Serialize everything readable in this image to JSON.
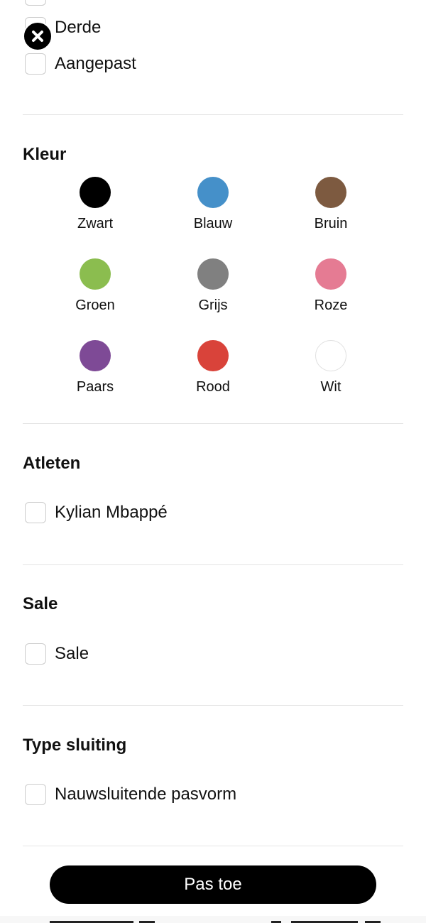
{
  "filters": {
    "top_options": [
      {
        "label": "Derde",
        "checked": false
      },
      {
        "label": "Aangepast",
        "checked": false
      }
    ],
    "colors": {
      "title": "Kleur",
      "swatches": [
        {
          "label": "Zwart",
          "color": "#000000"
        },
        {
          "label": "Blauw",
          "color": "#4590c9"
        },
        {
          "label": "Bruin",
          "color": "#7d5a40"
        },
        {
          "label": "Groen",
          "color": "#8bbd4f"
        },
        {
          "label": "Grijs",
          "color": "#808080"
        },
        {
          "label": "Roze",
          "color": "#e57b93"
        },
        {
          "label": "Paars",
          "color": "#7e4a96"
        },
        {
          "label": "Rood",
          "color": "#d9433a"
        },
        {
          "label": "Wit",
          "color": "#ffffff"
        }
      ]
    },
    "athletes": {
      "title": "Atleten",
      "options": [
        {
          "label": "Kylian Mbappé",
          "checked": false
        }
      ]
    },
    "sale": {
      "title": "Sale",
      "options": [
        {
          "label": "Sale",
          "checked": false
        }
      ]
    },
    "closure": {
      "title": "Type sluiting",
      "options": [
        {
          "label": "Nauwsluitende pasvorm",
          "checked": false
        }
      ]
    }
  },
  "apply_button": {
    "label": "Pas toe"
  }
}
